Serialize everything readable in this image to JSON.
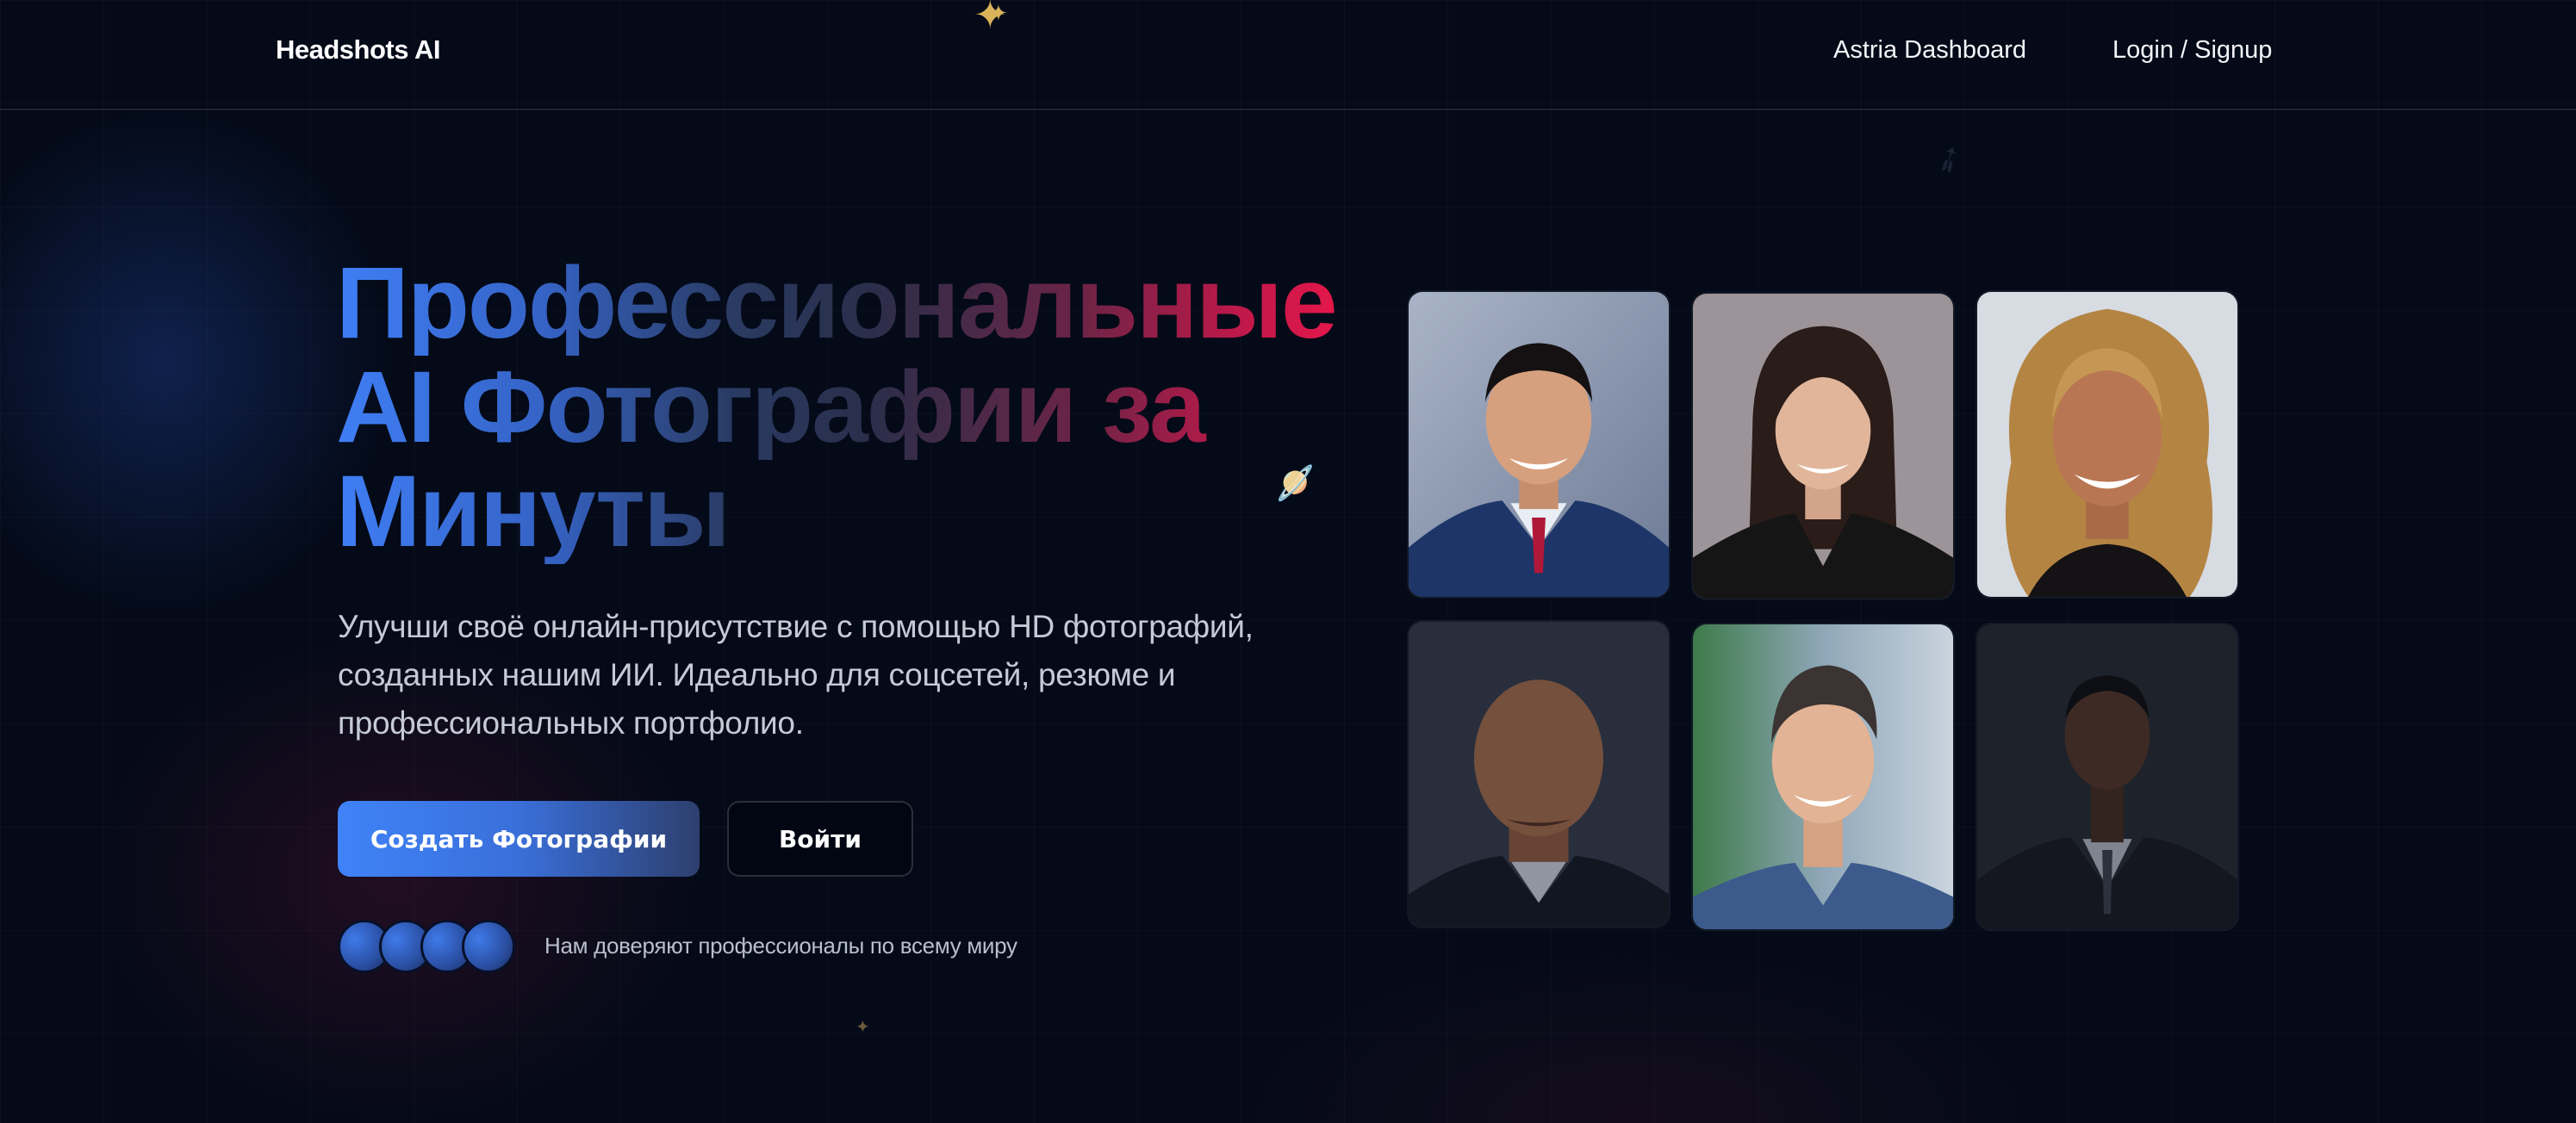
{
  "header": {
    "brand": "Headshots AI",
    "nav": {
      "dashboard": "Astria Dashboard",
      "login": "Login / Signup"
    }
  },
  "hero": {
    "title_lines": [
      "Профессиональные",
      "AI Фотографии за",
      "Минуты"
    ],
    "subtitle_lines": [
      "Улучши своё онлайн-присутствие с помощью HD фотографий,",
      "созданных нашим ИИ. Идеально для соцсетей, резюме и",
      "профессиональных портфолио."
    ],
    "primary_button": "Создать Фотографии",
    "secondary_button": "Войти",
    "trust_text": "Нам доверяют профессионалы по всему миру"
  },
  "icons": {
    "sparkle": "sparkle-icon",
    "planet": "planet-icon",
    "rocket": "rocket-icon"
  },
  "colors": {
    "background": "#040a18",
    "accent_blue": "#3f83f8",
    "accent_red": "#e3174a",
    "gold_sparkle": "#d9b25a"
  }
}
